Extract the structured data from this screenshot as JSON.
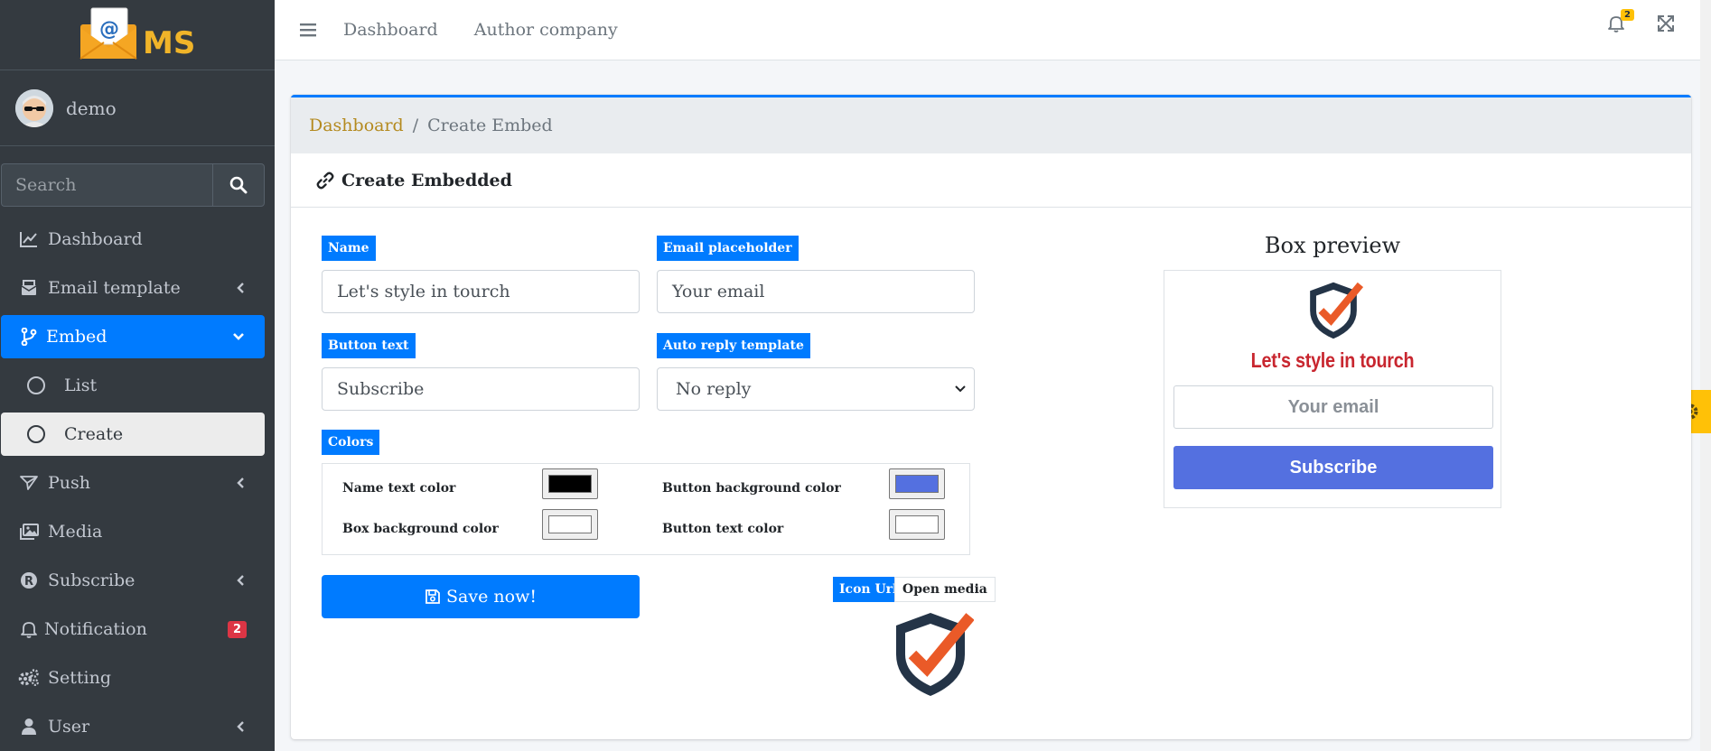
{
  "sidebar": {
    "brand": "MS",
    "user": "demo",
    "search_placeholder": "Search",
    "items": [
      {
        "label": "Dashboard"
      },
      {
        "label": "Email template"
      },
      {
        "label": "Embed"
      },
      {
        "label": "List"
      },
      {
        "label": "Create"
      },
      {
        "label": "Push"
      },
      {
        "label": "Media"
      },
      {
        "label": "Subscribe"
      },
      {
        "label": "Notification",
        "badge": "2"
      },
      {
        "label": "Setting"
      },
      {
        "label": "User"
      }
    ]
  },
  "topbar": {
    "links": [
      "Dashboard",
      "Author company"
    ],
    "notification_count": "2"
  },
  "breadcrumb": {
    "home": "Dashboard",
    "separator": "/",
    "current": "Create Embed"
  },
  "card": {
    "title": "Create Embedded"
  },
  "form": {
    "name_label": "Name",
    "name_value": "Let's style in tourch",
    "email_placeholder_label": "Email placeholder",
    "email_placeholder_value": "Your email",
    "button_text_label": "Button text",
    "button_text_value": "Subscribe",
    "auto_reply_label": "Auto reply template",
    "auto_reply_value": "No reply",
    "colors_label": "Colors",
    "colors": {
      "name_text_label": "Name text color",
      "name_text_color": "#000000",
      "button_bg_label": "Button background color",
      "button_bg_color": "#5470e0",
      "box_bg_label": "Box background color",
      "box_bg_color": "#ffffff",
      "button_text_label": "Button text color",
      "button_text_color": "#ffffff"
    },
    "save_label": "Save now!",
    "icon_url_label": "Icon Url",
    "open_media_label": "Open media"
  },
  "preview": {
    "title": "Box preview",
    "name": "Let's style in tourch",
    "email_placeholder": "Your email",
    "button": "Subscribe"
  }
}
